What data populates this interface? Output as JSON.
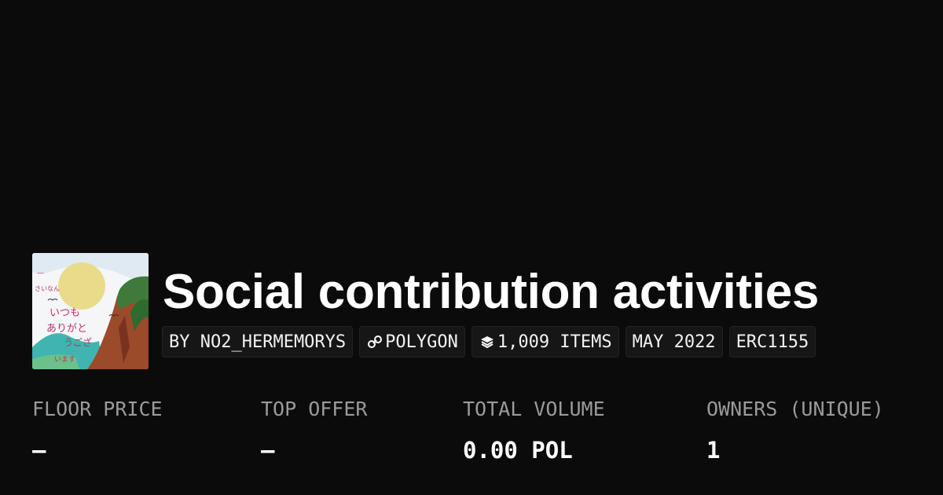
{
  "collection": {
    "title": "Social contribution activities",
    "thumbnail_icon": "collection-artwork-image"
  },
  "chips": [
    {
      "label": "BY NO2_HERMEMORYS",
      "icon": ""
    },
    {
      "label": "POLYGON",
      "icon": "link-chain-icon"
    },
    {
      "label": "1,009 ITEMS",
      "icon": "layers-stack-icon"
    },
    {
      "label": "MAY 2022",
      "icon": ""
    },
    {
      "label": "ERC1155",
      "icon": ""
    }
  ],
  "stats": [
    {
      "label": "FLOOR PRICE",
      "value": "–"
    },
    {
      "label": "TOP OFFER",
      "value": "–"
    },
    {
      "label": "TOTAL VOLUME",
      "value": "0.00 POL"
    },
    {
      "label": "OWNERS (UNIQUE)",
      "value": "1"
    }
  ],
  "colors": {
    "background": "#0b0b0b",
    "text": "#ffffff",
    "muted": "#9a9a9a",
    "chip": "#161616"
  }
}
